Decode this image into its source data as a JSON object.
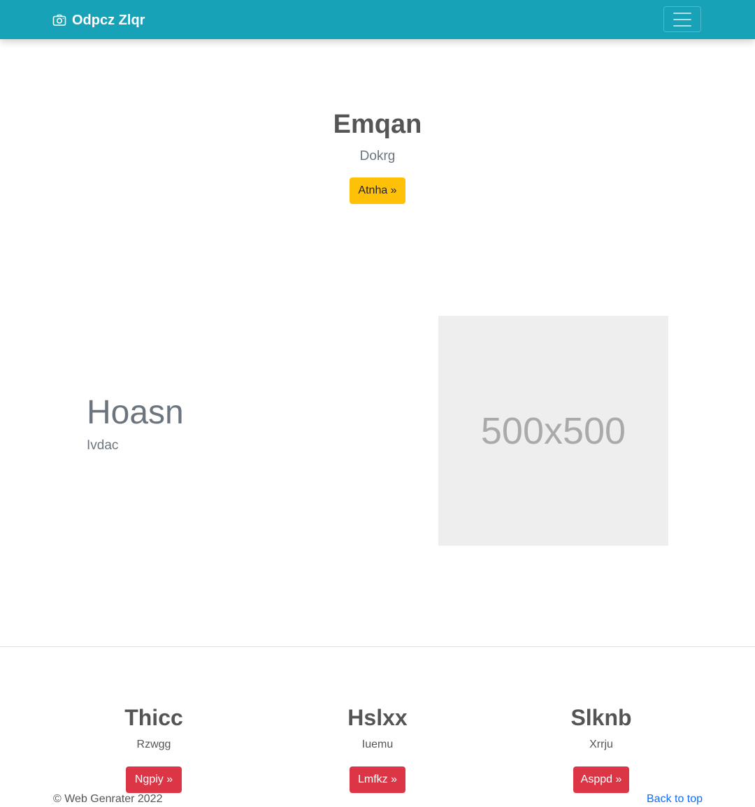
{
  "navbar": {
    "brand_text": "Odpcz Zlqr",
    "brand_icon": "camera-icon",
    "toggler_icon": "hamburger-menu-icon",
    "background_color": "#17a2b8"
  },
  "hero": {
    "title": "Emqan",
    "subtitle": "Dokrg",
    "button_label": "Atnha »",
    "button_color": "#ffc107"
  },
  "feature": {
    "title": "Hoasn",
    "subtitle": "Ivdac",
    "image_placeholder_text": "500x500"
  },
  "columns": [
    {
      "title": "Thicc",
      "subtitle": "Rzwgg",
      "button_label": "Ngpiy »"
    },
    {
      "title": "Hslxx",
      "subtitle": "Iuemu",
      "button_label": "Lmfkz »"
    },
    {
      "title": "Slknb",
      "subtitle": "Xrrju",
      "button_label": "Asppd »"
    }
  ],
  "footer": {
    "copyright": "© Web Genrater 2022",
    "back_to_top": "Back to top",
    "link_color": "#0d6efd"
  },
  "colors": {
    "danger": "#dc3545",
    "placeholder_bg": "#eeeeee"
  }
}
